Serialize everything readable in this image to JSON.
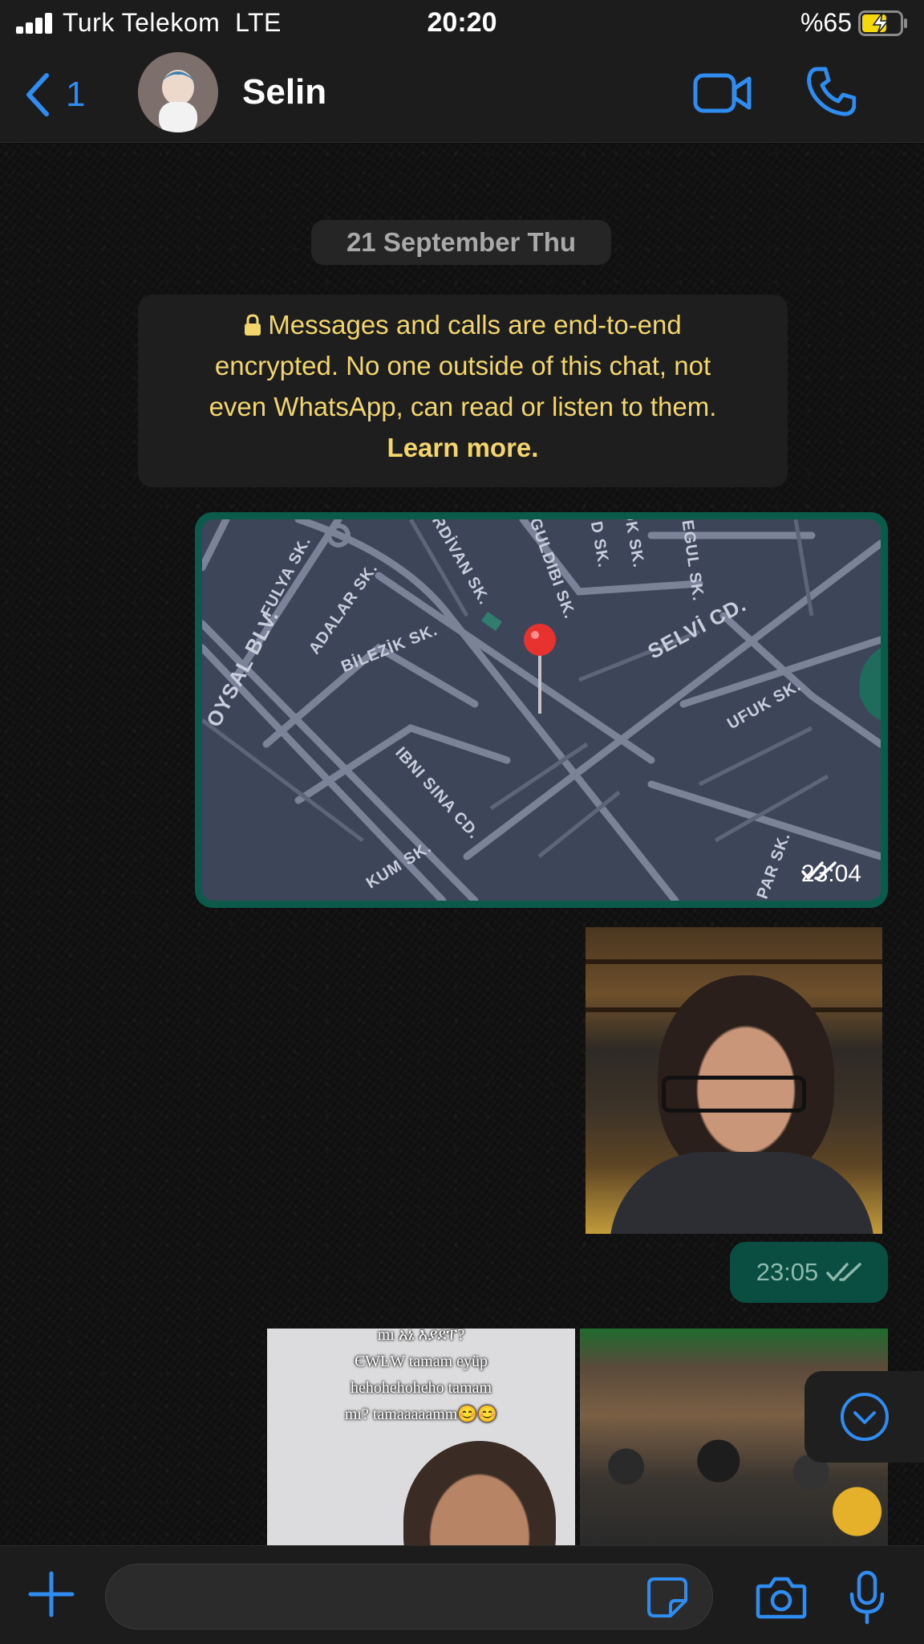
{
  "status_bar": {
    "carrier": "Turk Telekom",
    "network": "LTE",
    "time": "20:20",
    "battery": "%65",
    "battery_level_percent": 65,
    "charging": true
  },
  "header": {
    "back_count": "1",
    "contact_name": "Selin",
    "accent_color": "#2f8cf0"
  },
  "chat": {
    "date_label": "21 September Thu",
    "encryption": {
      "line1": "Messages and calls are end-to-end",
      "line2": "encrypted. No one outside of this chat, not",
      "line3": "even WhatsApp, can read or listen to them.",
      "learn_more": "Learn more."
    },
    "location_message": {
      "time": "23:04",
      "streets": [
        "FULYA SK.",
        "ADALAR SK.",
        "RDİVAN SK.",
        "GULDIBI SK.",
        "OK SK.",
        "D SK.",
        "EGUL SK.",
        "SELVİ CD.",
        "BİLEZİK SK.",
        "OYSAL BLV.",
        "UFUK SK.",
        "IBNI SINA CD.",
        "KUM SK.",
        "PAR SK."
      ]
    },
    "photo_message": {
      "time": "23:05"
    },
    "media_caption": {
      "line1": "mı አኔ እያደፐ?",
      "line2": "ЄWĿW tamam eyüp",
      "line3": "hehohehoheho tamam",
      "line4": "mı? tamaaaaamm😊😊"
    }
  },
  "input_bar": {
    "placeholder": ""
  },
  "icons": [
    "signal-icon",
    "battery-icon",
    "back-chevron-icon",
    "video-call-icon",
    "phone-icon",
    "lock-icon",
    "map-pin-icon",
    "double-check-icon",
    "chevron-down-icon",
    "plus-icon",
    "sticker-icon",
    "camera-icon",
    "microphone-icon"
  ]
}
